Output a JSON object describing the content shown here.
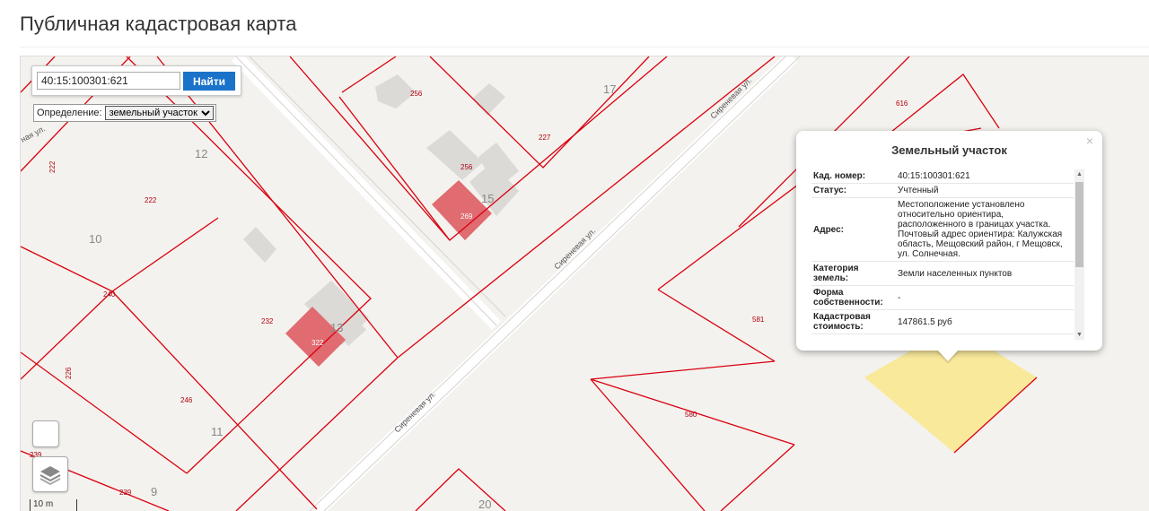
{
  "page": {
    "title": "Публичная кадастровая карта"
  },
  "search": {
    "value": "40:15:100301:621",
    "button_label": "Найти"
  },
  "definition": {
    "label": "Определение:",
    "selected": "земельный участок"
  },
  "scale": {
    "label": "10 m"
  },
  "map": {
    "colors": {
      "background": "#f4f2ee",
      "parcel_line": "#d9000f",
      "building_highlight": "#e06b70",
      "selected_parcel": "#f9e88c"
    },
    "parcel_labels": [
      "256",
      "227",
      "256",
      "269",
      "616",
      "222",
      "222",
      "240",
      "232",
      "322",
      "226",
      "246",
      "581",
      "580",
      "239",
      "239"
    ],
    "block_numbers": [
      "17",
      "12",
      "15",
      "10",
      "13",
      "11",
      "9",
      "20"
    ],
    "street_labels": [
      "Сиреневая ул.",
      "Сиреневая ул.",
      "Сиреневая ул.",
      "ная ул."
    ]
  },
  "popup": {
    "title": "Земельный участок",
    "close_glyph": "×",
    "rows": [
      {
        "key": "Кад. номер:",
        "value": "40:15:100301:621"
      },
      {
        "key": "Статус:",
        "value": "Учтенный"
      },
      {
        "key": "Адрес:",
        "value": "Местоположение установлено относительно ориентира, расположенного в границах участка. Почтовый адрес ориентира: Калужская область, Мещовский район, г Мещовск, ул. Солнечная."
      },
      {
        "key": "Категория земель:",
        "value": "Земли населенных пунктов"
      },
      {
        "key": "Форма собственности:",
        "value": "-"
      },
      {
        "key": "Кадастровая стоимость:",
        "value": "147861.5 руб"
      }
    ]
  },
  "icons": {
    "layers": "layers-icon"
  }
}
